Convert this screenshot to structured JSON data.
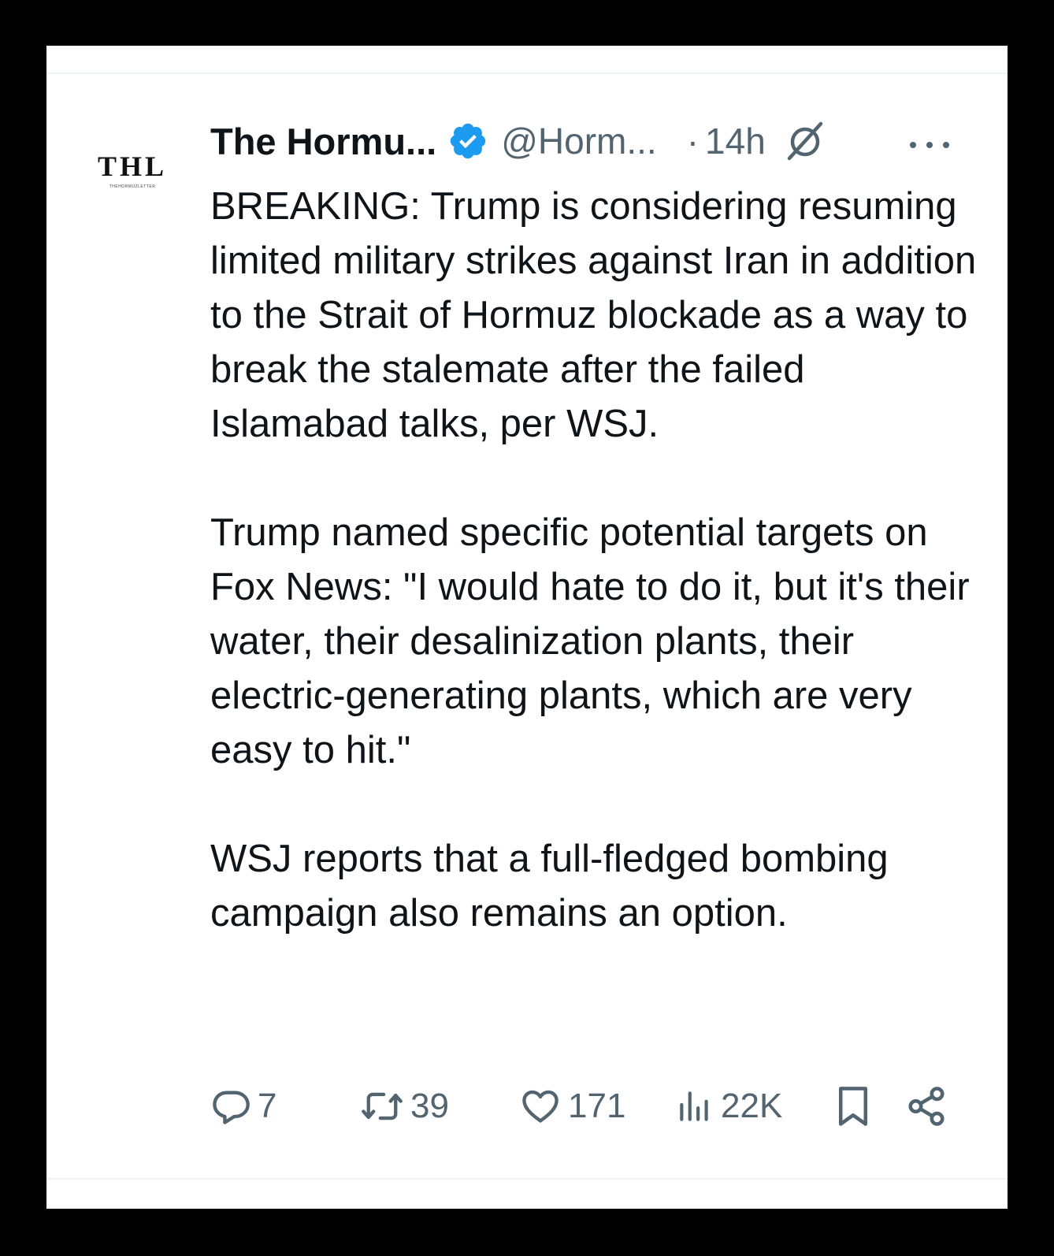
{
  "author": {
    "avatar_text": "THL",
    "avatar_subtext": "THEHORMUZLETTER",
    "display_name": "The Hormu...",
    "handle": "@Horm...",
    "separator": "·",
    "time": "14h",
    "verified": true
  },
  "tweet": {
    "paragraphs": [
      "BREAKING: Trump is considering resuming limited military strikes against Iran in addition to the Strait of Hormuz blockade as a way to break the stalemate after the failed Islamabad talks, per WSJ.",
      "Trump named specific potential targets on Fox News: \"I would hate to do it, but it's their water, their desalinization plants, their electric-generating plants, which are very easy to hit.\"",
      "WSJ reports that a full-fledged bombing campaign also remains an option."
    ]
  },
  "actions": {
    "replies": "7",
    "retweets": "39",
    "likes": "171",
    "views": "22K"
  },
  "icons": {
    "verified": "verified-badge-icon",
    "grok": "grok-icon",
    "more": "more-options-icon",
    "reply": "reply-icon",
    "retweet": "retweet-icon",
    "like": "heart-icon",
    "views": "views-icon",
    "bookmark": "bookmark-icon",
    "share": "share-icon"
  },
  "colors": {
    "text": "#0f1419",
    "secondary": "#536471",
    "verified_blue": "#1d9bf0",
    "frame": "#000000"
  }
}
